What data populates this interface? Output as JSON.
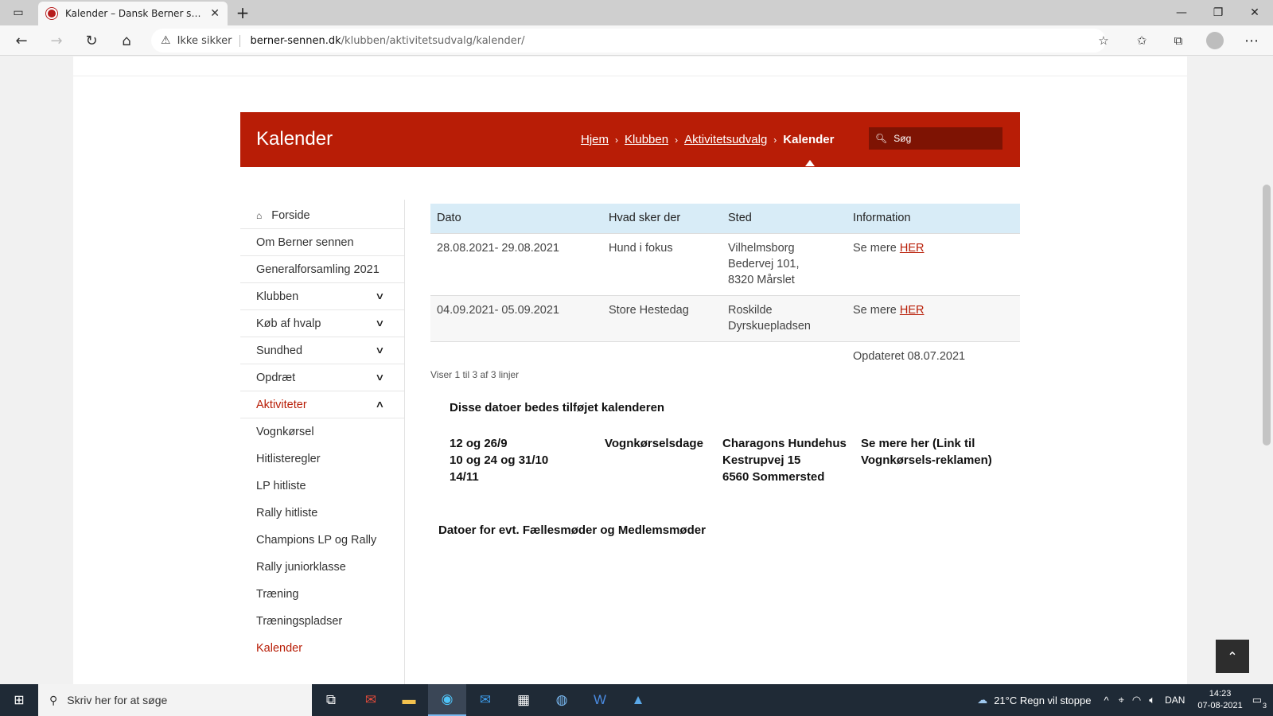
{
  "browser": {
    "tab_title": "Kalender – Dansk Berner sennen",
    "not_secure": "Ikke sikker",
    "url_host": "berner-sennen.dk",
    "url_path": "/klubben/aktivitetsudvalg/kalender/"
  },
  "header": {
    "title": "Kalender",
    "breadcrumb": [
      "Hjem",
      "Klubben",
      "Aktivitetsudvalg",
      "Kalender"
    ],
    "search_placeholder": "Søg"
  },
  "sidebar": {
    "items": [
      {
        "label": "Forside",
        "icon": "home-icon"
      },
      {
        "label": "Om Berner sennen"
      },
      {
        "label": "Generalforsamling 2021"
      },
      {
        "label": "Klubben",
        "expandable": true
      },
      {
        "label": "Køb af hvalp",
        "expandable": true
      },
      {
        "label": "Sundhed",
        "expandable": true
      },
      {
        "label": "Opdræt",
        "expandable": true
      },
      {
        "label": "Aktiviteter",
        "expandable": true,
        "expanded": true,
        "active": true
      }
    ],
    "subitems": [
      {
        "label": "Vognkørsel"
      },
      {
        "label": "Hitlisteregler"
      },
      {
        "label": "LP hitliste"
      },
      {
        "label": "Rally hitliste"
      },
      {
        "label": "Champions LP og Rally"
      },
      {
        "label": "Rally juniorklasse"
      },
      {
        "label": "Træning"
      },
      {
        "label": "Træningspladser"
      },
      {
        "label": "Kalender",
        "active": true
      }
    ]
  },
  "table": {
    "headers": [
      "Dato",
      "Hvad sker der",
      "Sted",
      "Information"
    ],
    "rows": [
      {
        "dato": "28.08.2021- 29.08.2021",
        "hvad": "Hund i fokus",
        "sted": [
          "Vilhelmsborg",
          "Bedervej 101,",
          "8320 Mårslet"
        ],
        "info_prefix": "Se mere ",
        "info_link": "HER"
      },
      {
        "dato": "04.09.2021- 05.09.2021",
        "hvad": "Store Hestedag",
        "sted": [
          "Roskilde",
          "Dyrskuepladsen"
        ],
        "info_prefix": "Se mere ",
        "info_link": "HER"
      }
    ],
    "updated": "Opdateret 08.07.2021",
    "info": "Viser 1 til 3 af 3 linjer"
  },
  "extra": {
    "title": "Disse datoer bedes tilføjet kalenderen",
    "dates": [
      "12 og 26/9",
      "10 og 24 og 31/10",
      "14/11"
    ],
    "event": "Vognkørselsdage",
    "place": [
      "Charagons Hundehus",
      " Kestrupvej 15",
      " 6560 Sommersted"
    ],
    "more": [
      "Se mere her (Link til",
      "Vognkørsels-reklamen)"
    ]
  },
  "meetings_title": "Datoer for evt. Fællesmøder og Medlemsmøder",
  "taskbar": {
    "search_placeholder": "Skriv her for at søge",
    "weather": "21°C  Regn vil stoppe",
    "lang": "DAN",
    "time": "14:23",
    "date": "07-08-2021",
    "notifications": "3"
  }
}
